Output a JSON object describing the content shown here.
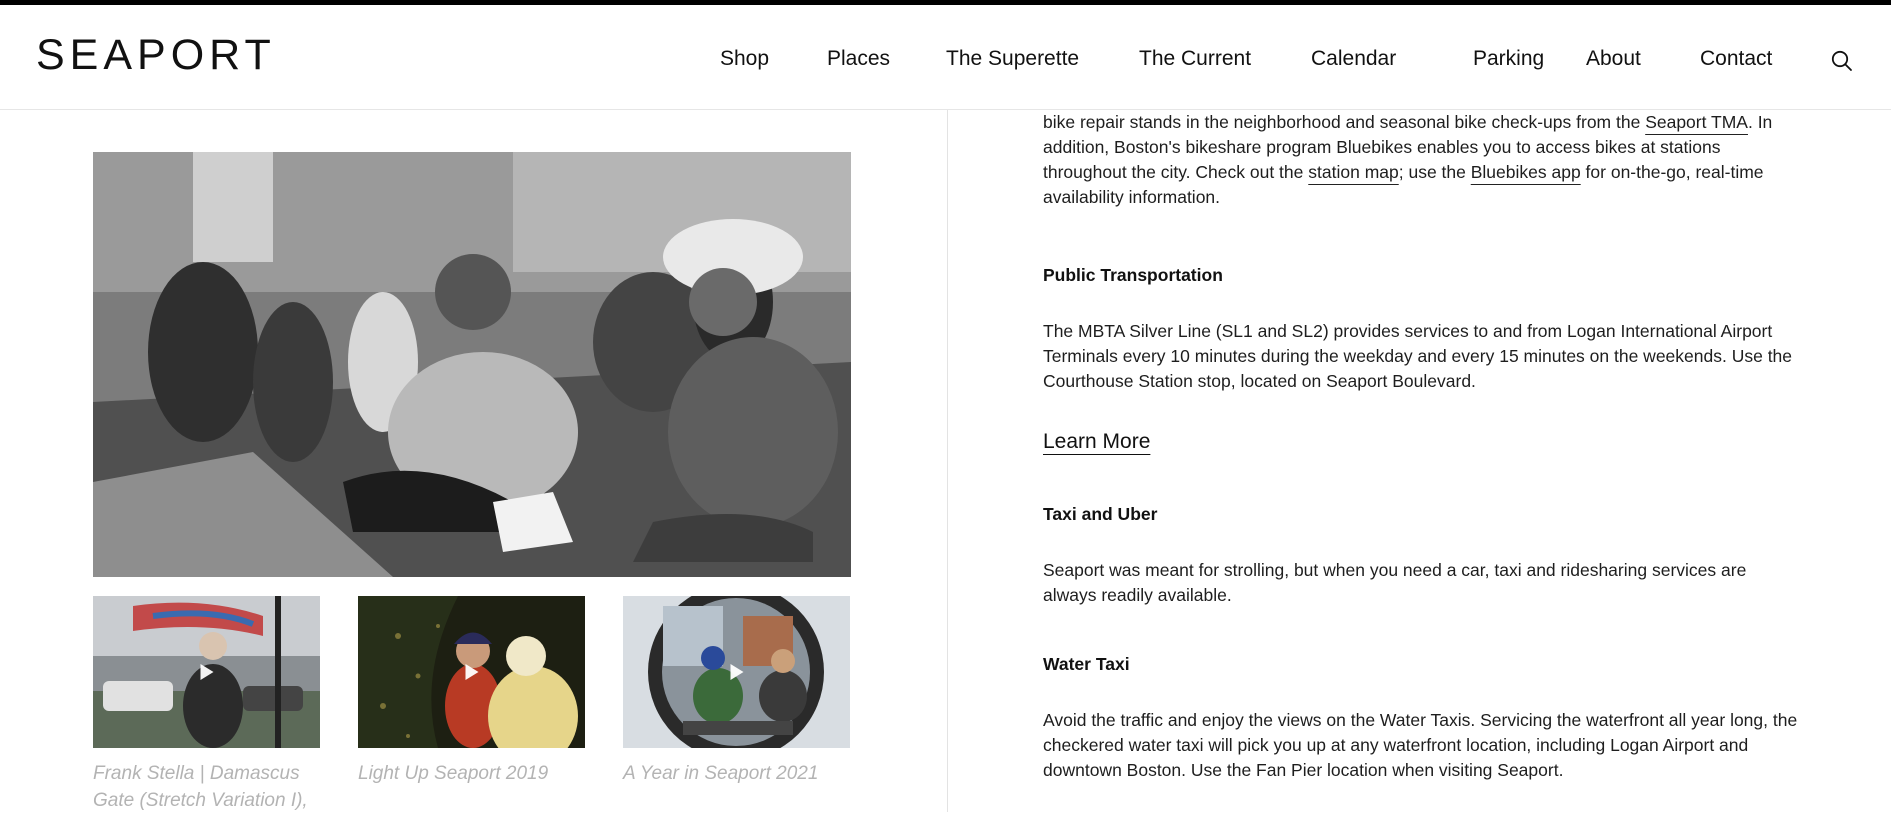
{
  "header": {
    "logo_text": "SEAPORT",
    "nav": [
      "Shop",
      "Places",
      "The Superette",
      "The Current",
      "Calendar",
      "Parking",
      "About",
      "Contact"
    ],
    "search_icon": "search-icon"
  },
  "media": {
    "hero_alt": "Two women sitting on grass talking",
    "thumbnails": [
      {
        "caption": "Frank Stella | Damascus Gate (Stretch Variation I),",
        "icon": "play-icon"
      },
      {
        "caption": "Light Up Seaport 2019",
        "icon": "play-icon"
      },
      {
        "caption": "A Year in Seaport 2021",
        "icon": "play-icon"
      }
    ]
  },
  "content": {
    "bike": {
      "t1": "bike repair stands in the neighborhood and seasonal bike check-ups from the ",
      "link1": "Seaport TMA",
      "t2": ". In addition, Boston's bikeshare program Bluebikes enables you to access bikes at stations throughout the city. Check out the ",
      "link2": "station map",
      "t3": "; use the ",
      "link3": "Bluebikes app",
      "t4": " for on-the-go, real-time availability information."
    },
    "public": {
      "heading": "Public Transportation",
      "body": "The MBTA Silver Line (SL1 and SL2) provides services to and from Logan International Airport Terminals every 10 minutes during the weekday and every 15 minutes on the weekends. Use the Courthouse Station stop, located on Seaport Boulevard.",
      "learn_more": "Learn More"
    },
    "taxi": {
      "heading": "Taxi and Uber",
      "body": "Seaport was meant for strolling, but when you need a car, taxi and ridesharing services are always readily available."
    },
    "water": {
      "heading": "Water Taxi",
      "body": "Avoid the traffic and enjoy the views on the Water Taxis. Servicing the waterfront all year long, the checkered water taxi will pick you up at any waterfront location, including Logan Airport and downtown Boston. Use the Fan Pier location when visiting Seaport."
    }
  }
}
